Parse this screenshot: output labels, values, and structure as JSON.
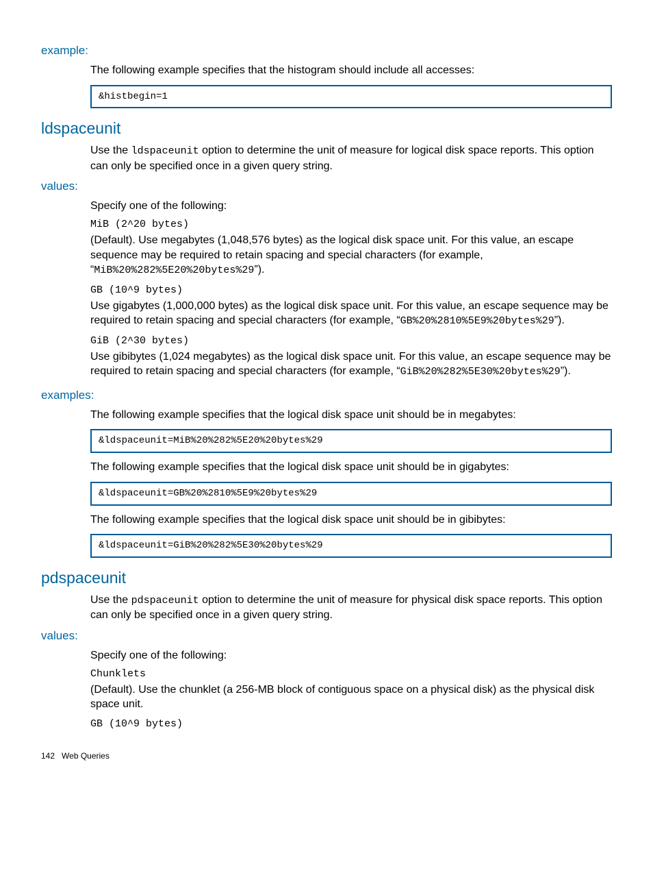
{
  "s1": {
    "heading": "example:",
    "intro": "The following example specifies that the histogram should include all accesses:",
    "code": "&histbegin=1"
  },
  "s2": {
    "heading": "ldspaceunit",
    "desc_pre": "Use the ",
    "desc_code": "ldspaceunit",
    "desc_post": " option to determine the unit of measure for logical disk space reports. This option can only be specified once in a given query string."
  },
  "s3": {
    "heading": "values:",
    "lead": "Specify one of the following:",
    "v1_code": "MiB (2^20 bytes)",
    "v1_text_a": "(Default). Use megabytes (1,048,576 bytes) as the logical disk space unit. For this value, an escape sequence may be required to retain spacing and special characters (for example, “",
    "v1_text_mono": "MiB%20%282%5E20%20bytes%29",
    "v1_text_b": "”).",
    "v2_code": "GB (10^9 bytes)",
    "v2_text_a": "Use gigabytes (1,000,000 bytes) as the logical disk space unit. For this value, an escape sequence may be required to retain spacing and special characters (for example, “",
    "v2_text_mono": "GB%20%2810%5E9%20bytes%29",
    "v2_text_b": "”).",
    "v3_code": "GiB (2^30 bytes)",
    "v3_text_a": "Use gibibytes (1,024 megabytes) as the logical disk space unit. For this value, an escape sequence may be required to retain spacing and special characters (for example, “",
    "v3_text_mono": "GiB%20%282%5E30%20bytes%29",
    "v3_text_b": "”)."
  },
  "s4": {
    "heading": "examples:",
    "e1_text": "The following example specifies that the logical disk space unit should be in megabytes:",
    "e1_code": "&ldspaceunit=MiB%20%282%5E20%20bytes%29",
    "e2_text": "The following example specifies that the logical disk space unit should be in gigabytes:",
    "e2_code": "&ldspaceunit=GB%20%2810%5E9%20bytes%29",
    "e3_text": "The following example specifies that the logical disk space unit should be in gibibytes:",
    "e3_code": "&ldspaceunit=GiB%20%282%5E30%20bytes%29"
  },
  "s5": {
    "heading": "pdspaceunit",
    "desc_pre": "Use the ",
    "desc_code": "pdspaceunit",
    "desc_post": " option to determine the unit of measure for physical disk space reports. This option can only be specified once in a given query string."
  },
  "s6": {
    "heading": "values:",
    "lead": "Specify one of the following:",
    "v1_code": "Chunklets",
    "v1_text": "(Default). Use the chunklet (a 256-MB block of contiguous space on a physical disk) as the physical disk space unit.",
    "v2_code": "GB (10^9 bytes)"
  },
  "footer": {
    "page": "142",
    "title": "Web Queries"
  }
}
